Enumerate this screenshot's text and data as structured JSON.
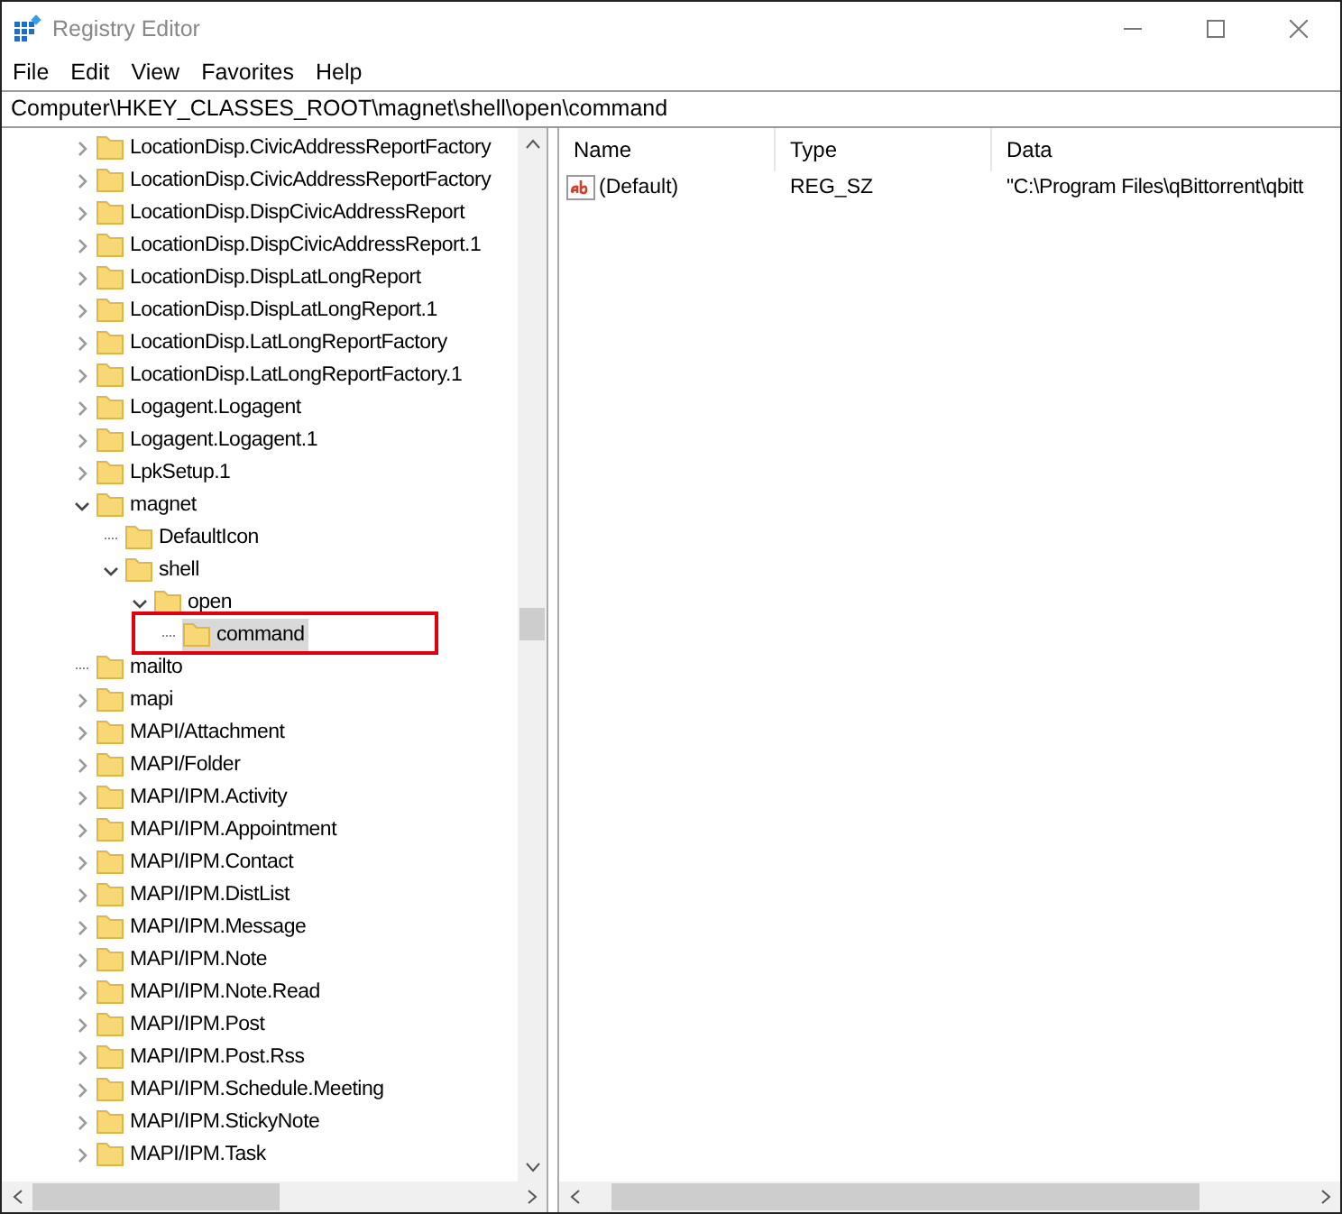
{
  "window": {
    "title": "Registry Editor"
  },
  "menu": [
    "File",
    "Edit",
    "View",
    "Favorites",
    "Help"
  ],
  "address": "Computer\\HKEY_CLASSES_ROOT\\magnet\\shell\\open\\command",
  "tree": {
    "items": [
      {
        "label": "LocationDisp.CivicAddressReportFactory",
        "kind": "branch",
        "expanded": false,
        "selected": false
      },
      {
        "label": "LocationDisp.CivicAddressReportFactory",
        "kind": "branch",
        "expanded": false,
        "selected": false
      },
      {
        "label": "LocationDisp.DispCivicAddressReport",
        "kind": "branch",
        "expanded": false,
        "selected": false
      },
      {
        "label": "LocationDisp.DispCivicAddressReport.1",
        "kind": "branch",
        "expanded": false,
        "selected": false
      },
      {
        "label": "LocationDisp.DispLatLongReport",
        "kind": "branch",
        "expanded": false,
        "selected": false
      },
      {
        "label": "LocationDisp.DispLatLongReport.1",
        "kind": "branch",
        "expanded": false,
        "selected": false
      },
      {
        "label": "LocationDisp.LatLongReportFactory",
        "kind": "branch",
        "expanded": false,
        "selected": false
      },
      {
        "label": "LocationDisp.LatLongReportFactory.1",
        "kind": "branch",
        "expanded": false,
        "selected": false
      },
      {
        "label": "Logagent.Logagent",
        "kind": "branch",
        "expanded": false,
        "selected": false
      },
      {
        "label": "Logagent.Logagent.1",
        "kind": "branch",
        "expanded": false,
        "selected": false
      },
      {
        "label": "LpkSetup.1",
        "kind": "branch",
        "expanded": false,
        "selected": false
      },
      {
        "label": "magnet",
        "kind": "branch",
        "expanded": true,
        "selected": false,
        "children": [
          {
            "label": "DefaultIcon",
            "kind": "leaf",
            "selected": false
          },
          {
            "label": "shell",
            "kind": "branch",
            "expanded": true,
            "selected": false,
            "children": [
              {
                "label": "open",
                "kind": "branch",
                "expanded": true,
                "selected": false,
                "children": [
                  {
                    "label": "command",
                    "kind": "leaf",
                    "selected": true
                  }
                ]
              }
            ]
          }
        ]
      },
      {
        "label": "mailto",
        "kind": "leaf",
        "selected": false
      },
      {
        "label": "mapi",
        "kind": "branch",
        "expanded": false,
        "selected": false
      },
      {
        "label": "MAPI/Attachment",
        "kind": "branch",
        "expanded": false,
        "selected": false
      },
      {
        "label": "MAPI/Folder",
        "kind": "branch",
        "expanded": false,
        "selected": false
      },
      {
        "label": "MAPI/IPM.Activity",
        "kind": "branch",
        "expanded": false,
        "selected": false
      },
      {
        "label": "MAPI/IPM.Appointment",
        "kind": "branch",
        "expanded": false,
        "selected": false
      },
      {
        "label": "MAPI/IPM.Contact",
        "kind": "branch",
        "expanded": false,
        "selected": false
      },
      {
        "label": "MAPI/IPM.DistList",
        "kind": "branch",
        "expanded": false,
        "selected": false
      },
      {
        "label": "MAPI/IPM.Message",
        "kind": "branch",
        "expanded": false,
        "selected": false
      },
      {
        "label": "MAPI/IPM.Note",
        "kind": "branch",
        "expanded": false,
        "selected": false
      },
      {
        "label": "MAPI/IPM.Note.Read",
        "kind": "branch",
        "expanded": false,
        "selected": false
      },
      {
        "label": "MAPI/IPM.Post",
        "kind": "branch",
        "expanded": false,
        "selected": false
      },
      {
        "label": "MAPI/IPM.Post.Rss",
        "kind": "branch",
        "expanded": false,
        "selected": false
      },
      {
        "label": "MAPI/IPM.Schedule.Meeting",
        "kind": "branch",
        "expanded": false,
        "selected": false
      },
      {
        "label": "MAPI/IPM.StickyNote",
        "kind": "branch",
        "expanded": false,
        "selected": false
      },
      {
        "label": "MAPI/IPM.Task",
        "kind": "branch",
        "expanded": false,
        "selected": false
      }
    ]
  },
  "values": {
    "columns": [
      "Name",
      "Type",
      "Data"
    ],
    "rows": [
      {
        "name": "(Default)",
        "type": "REG_SZ",
        "data": "\"C:\\Program Files\\qBittorrent\\qbitt"
      }
    ]
  }
}
